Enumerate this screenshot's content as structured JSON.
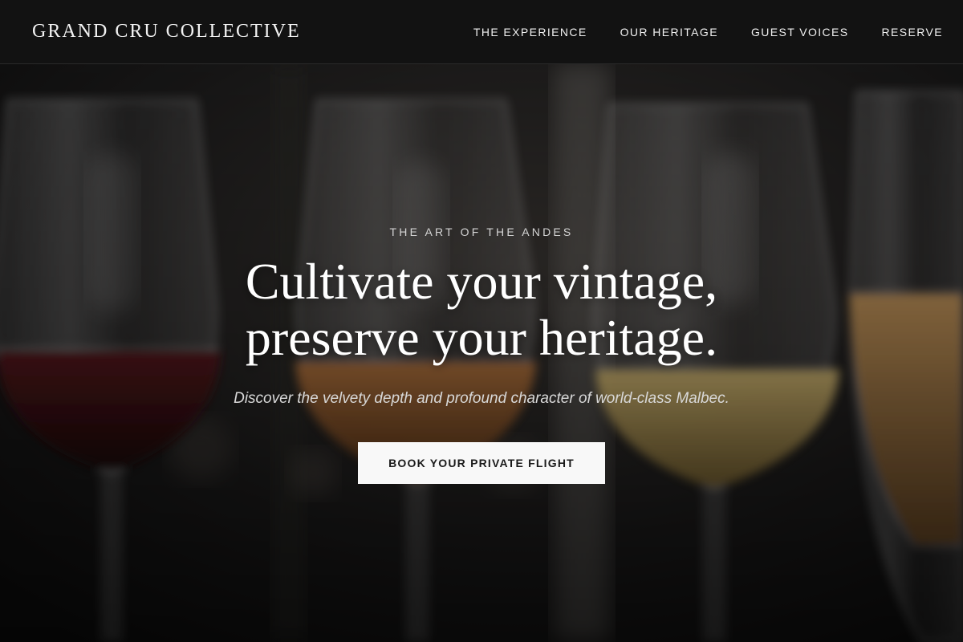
{
  "header": {
    "brand": "GRAND CRU COLLECTIVE",
    "nav": [
      {
        "label": "THE EXPERIENCE"
      },
      {
        "label": "OUR HERITAGE"
      },
      {
        "label": "GUEST VOICES"
      },
      {
        "label": "RESERVE"
      }
    ]
  },
  "hero": {
    "eyebrow": "THE ART OF THE ANDES",
    "headline_line1": "Cultivate your vintage,",
    "headline_line2": "preserve your heritage.",
    "subline": "Discover the velvety depth and profound character of world-class Malbec.",
    "cta_label": "BOOK YOUR PRIVATE FLIGHT",
    "background_image": "wine-glasses-photo"
  },
  "colors": {
    "header_bg": "#121212",
    "cta_bg": "#f8f8f8",
    "text_light": "#ffffff",
    "red_wine": "#4a1418",
    "amber_wine": "#a86a36",
    "white_wine": "#c9a85c"
  }
}
